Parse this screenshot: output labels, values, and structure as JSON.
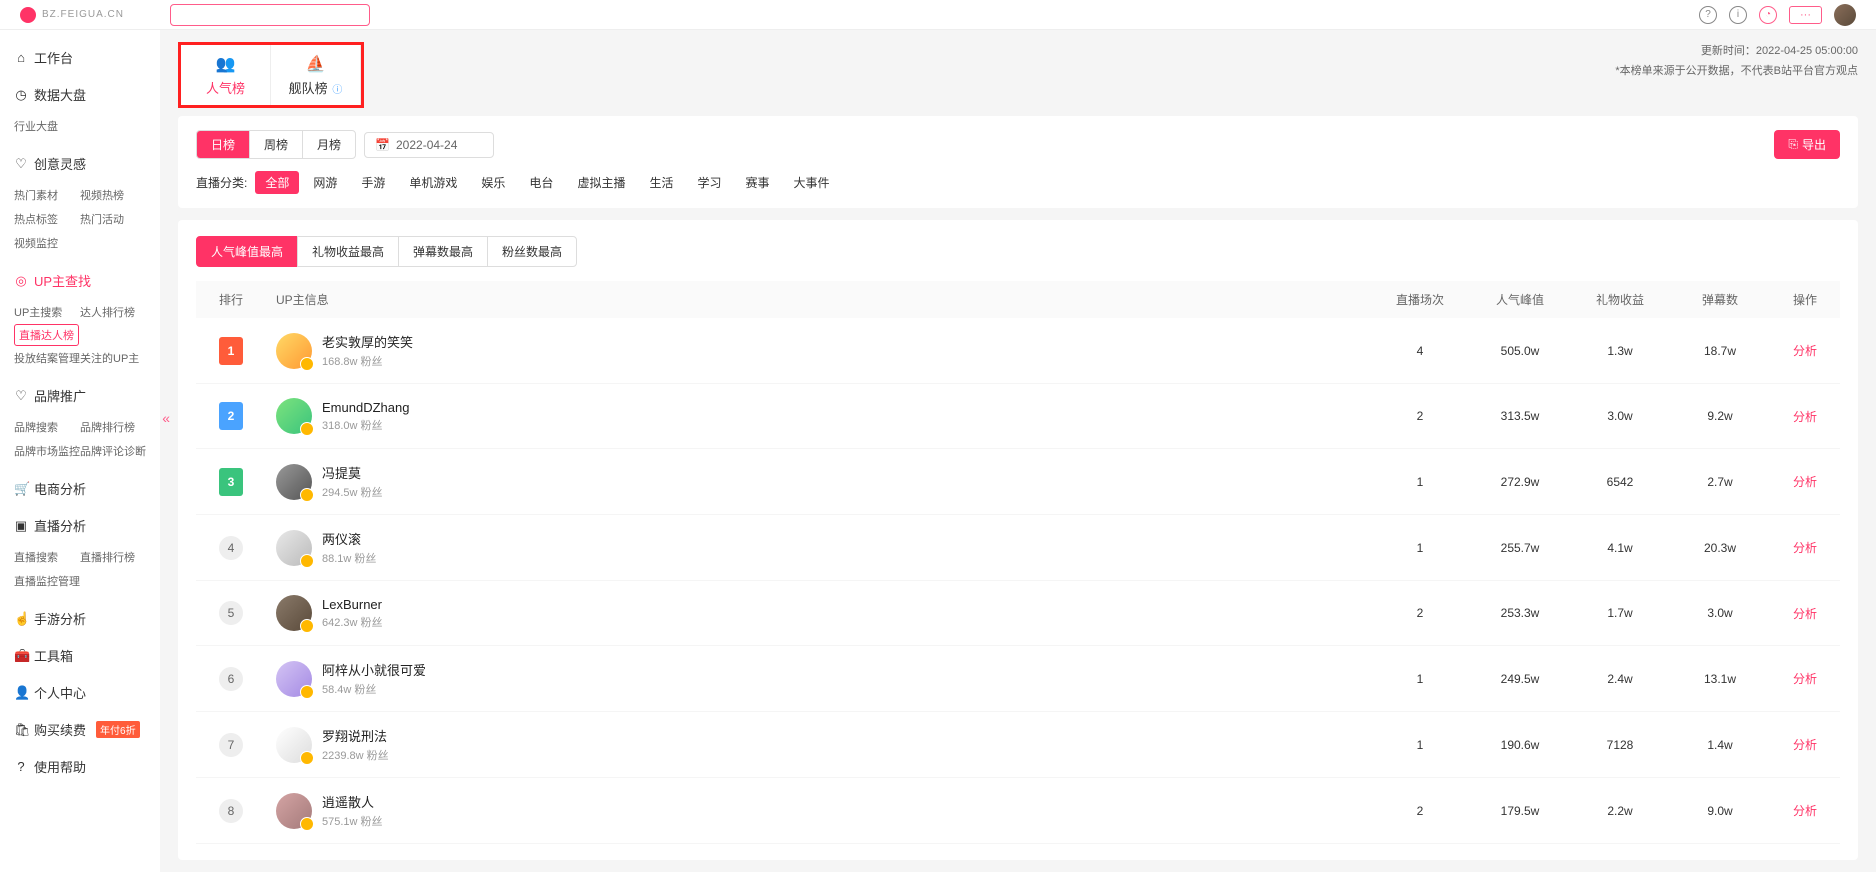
{
  "header": {
    "logo": "BZ.FEIGUA.CN"
  },
  "sidebar": {
    "groups": [
      {
        "icon": "⌂",
        "title": "工作台",
        "sub": []
      },
      {
        "icon": "◷",
        "title": "数据大盘",
        "sub": [
          {
            "t": "行业大盘"
          }
        ]
      },
      {
        "icon": "♡",
        "title": "创意灵感",
        "sub": [
          {
            "t": "热门素材"
          },
          {
            "t": "视频热榜"
          },
          {
            "t": "热点标签"
          },
          {
            "t": "热门活动"
          },
          {
            "t": "视频监控"
          }
        ]
      },
      {
        "icon": "◎",
        "title": "UP主查找",
        "active": true,
        "sub": [
          {
            "t": "UP主搜索"
          },
          {
            "t": "达人排行榜"
          },
          {
            "t": "直播达人榜",
            "active": true
          },
          {
            "t": "投放结案管理"
          },
          {
            "t": "关注的UP主"
          }
        ]
      },
      {
        "icon": "♡",
        "title": "品牌推广",
        "sub": [
          {
            "t": "品牌搜索"
          },
          {
            "t": "品牌排行榜"
          },
          {
            "t": "品牌市场监控"
          },
          {
            "t": "品牌评论诊断"
          }
        ]
      },
      {
        "icon": "🛒",
        "title": "电商分析",
        "sub": []
      },
      {
        "icon": "▣",
        "title": "直播分析",
        "sub": [
          {
            "t": "直播搜索"
          },
          {
            "t": "直播排行榜"
          },
          {
            "t": "直播监控管理"
          }
        ]
      },
      {
        "icon": "☝",
        "title": "手游分析",
        "sub": []
      },
      {
        "icon": "🧰",
        "title": "工具箱",
        "sub": []
      },
      {
        "icon": "👤",
        "title": "个人中心",
        "sub": []
      },
      {
        "icon": "🛍",
        "title": "购买续费",
        "badge": "年付6折",
        "sub": []
      },
      {
        "icon": "?",
        "title": "使用帮助",
        "sub": []
      }
    ]
  },
  "rankTabs": [
    {
      "icon": "👥",
      "label": "人气榜",
      "active": true
    },
    {
      "icon": "⛵",
      "label": "舰队榜",
      "info": true
    }
  ],
  "meta": {
    "updated": "更新时间：2022-04-25 05:00:00",
    "note": "*本榜单来源于公开数据，不代表B站平台官方观点"
  },
  "periods": [
    {
      "t": "日榜",
      "active": true
    },
    {
      "t": "周榜"
    },
    {
      "t": "月榜"
    }
  ],
  "date": "2022-04-24",
  "exportLabel": "导出",
  "catLabel": "直播分类:",
  "cats": [
    {
      "t": "全部",
      "active": true
    },
    {
      "t": "网游"
    },
    {
      "t": "手游"
    },
    {
      "t": "单机游戏"
    },
    {
      "t": "娱乐"
    },
    {
      "t": "电台"
    },
    {
      "t": "虚拟主播"
    },
    {
      "t": "生活"
    },
    {
      "t": "学习"
    },
    {
      "t": "赛事"
    },
    {
      "t": "大事件"
    }
  ],
  "sortTabs": [
    {
      "t": "人气峰值最高",
      "active": true
    },
    {
      "t": "礼物收益最高"
    },
    {
      "t": "弹幕数最高"
    },
    {
      "t": "粉丝数最高"
    }
  ],
  "columns": [
    "排行",
    "UP主信息",
    "直播场次",
    "人气峰值",
    "礼物收益",
    "弹幕数",
    "操作"
  ],
  "actionLabel": "分析",
  "fansSuffix": "粉丝",
  "rows": [
    {
      "rank": 1,
      "name": "老实敦厚的笑笑",
      "fans": "168.8w",
      "sessions": "4",
      "peak": "505.0w",
      "gift": "1.3w",
      "danmu": "18.7w",
      "av": "av1"
    },
    {
      "rank": 2,
      "name": "EmundDZhang",
      "fans": "318.0w",
      "sessions": "2",
      "peak": "313.5w",
      "gift": "3.0w",
      "danmu": "9.2w",
      "av": "av2"
    },
    {
      "rank": 3,
      "name": "冯提莫",
      "fans": "294.5w",
      "sessions": "1",
      "peak": "272.9w",
      "gift": "6542",
      "danmu": "2.7w",
      "av": "av3"
    },
    {
      "rank": 4,
      "name": "两仪滚",
      "fans": "88.1w",
      "sessions": "1",
      "peak": "255.7w",
      "gift": "4.1w",
      "danmu": "20.3w",
      "av": "av4"
    },
    {
      "rank": 5,
      "name": "LexBurner",
      "fans": "642.3w",
      "sessions": "2",
      "peak": "253.3w",
      "gift": "1.7w",
      "danmu": "3.0w",
      "av": "av5"
    },
    {
      "rank": 6,
      "name": "阿梓从小就很可爱",
      "fans": "58.4w",
      "sessions": "1",
      "peak": "249.5w",
      "gift": "2.4w",
      "danmu": "13.1w",
      "av": "av6"
    },
    {
      "rank": 7,
      "name": "罗翔说刑法",
      "fans": "2239.8w",
      "sessions": "1",
      "peak": "190.6w",
      "gift": "7128",
      "danmu": "1.4w",
      "av": "av7"
    },
    {
      "rank": 8,
      "name": "逍遥散人",
      "fans": "575.1w",
      "sessions": "2",
      "peak": "179.5w",
      "gift": "2.2w",
      "danmu": "9.0w",
      "av": "av8"
    }
  ]
}
